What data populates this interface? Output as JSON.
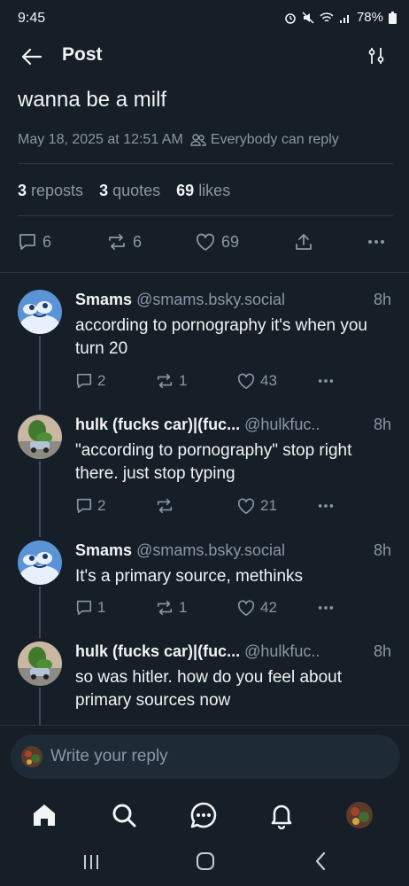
{
  "status_bar": {
    "time": "9:45",
    "battery": "78%"
  },
  "header": {
    "title": "Post"
  },
  "post": {
    "text": "wanna be a milf",
    "date": "May 18, 2025 at 12:51 AM",
    "reply_setting": "Everybody can reply",
    "reposts_count": "3",
    "reposts_label": "reposts",
    "quotes_count": "3",
    "quotes_label": "quotes",
    "likes_count": "69",
    "likes_label": "likes",
    "actions": {
      "replies": "6",
      "reposts": "6",
      "likes": "69"
    }
  },
  "replies": [
    {
      "name": "Smams",
      "handle": "@smams.bsky.social",
      "time": "8h",
      "text": "according to pornography it's when you turn 20",
      "reply_count": "2",
      "repost_count": "1",
      "like_count": "43"
    },
    {
      "name": "hulk (fucks car)|(fuc...",
      "handle": "@hulkfuc..",
      "time": "8h",
      "text": "\"according to pornography\" stop right there. just stop typing",
      "reply_count": "2",
      "repost_count": "",
      "like_count": "21"
    },
    {
      "name": "Smams",
      "handle": "@smams.bsky.social",
      "time": "8h",
      "text": "It's a primary source, methinks",
      "reply_count": "1",
      "repost_count": "1",
      "like_count": "42"
    },
    {
      "name": "hulk (fucks car)|(fuc...",
      "handle": "@hulkfuc..",
      "time": "8h",
      "text": "so was hitler. how do you feel about primary sources now"
    }
  ],
  "composer": {
    "placeholder": "Write your reply"
  },
  "colors": {
    "background": "#161e27",
    "muted": "#8a97a6",
    "text": "#f1f3f5",
    "divider": "#2c3744"
  }
}
